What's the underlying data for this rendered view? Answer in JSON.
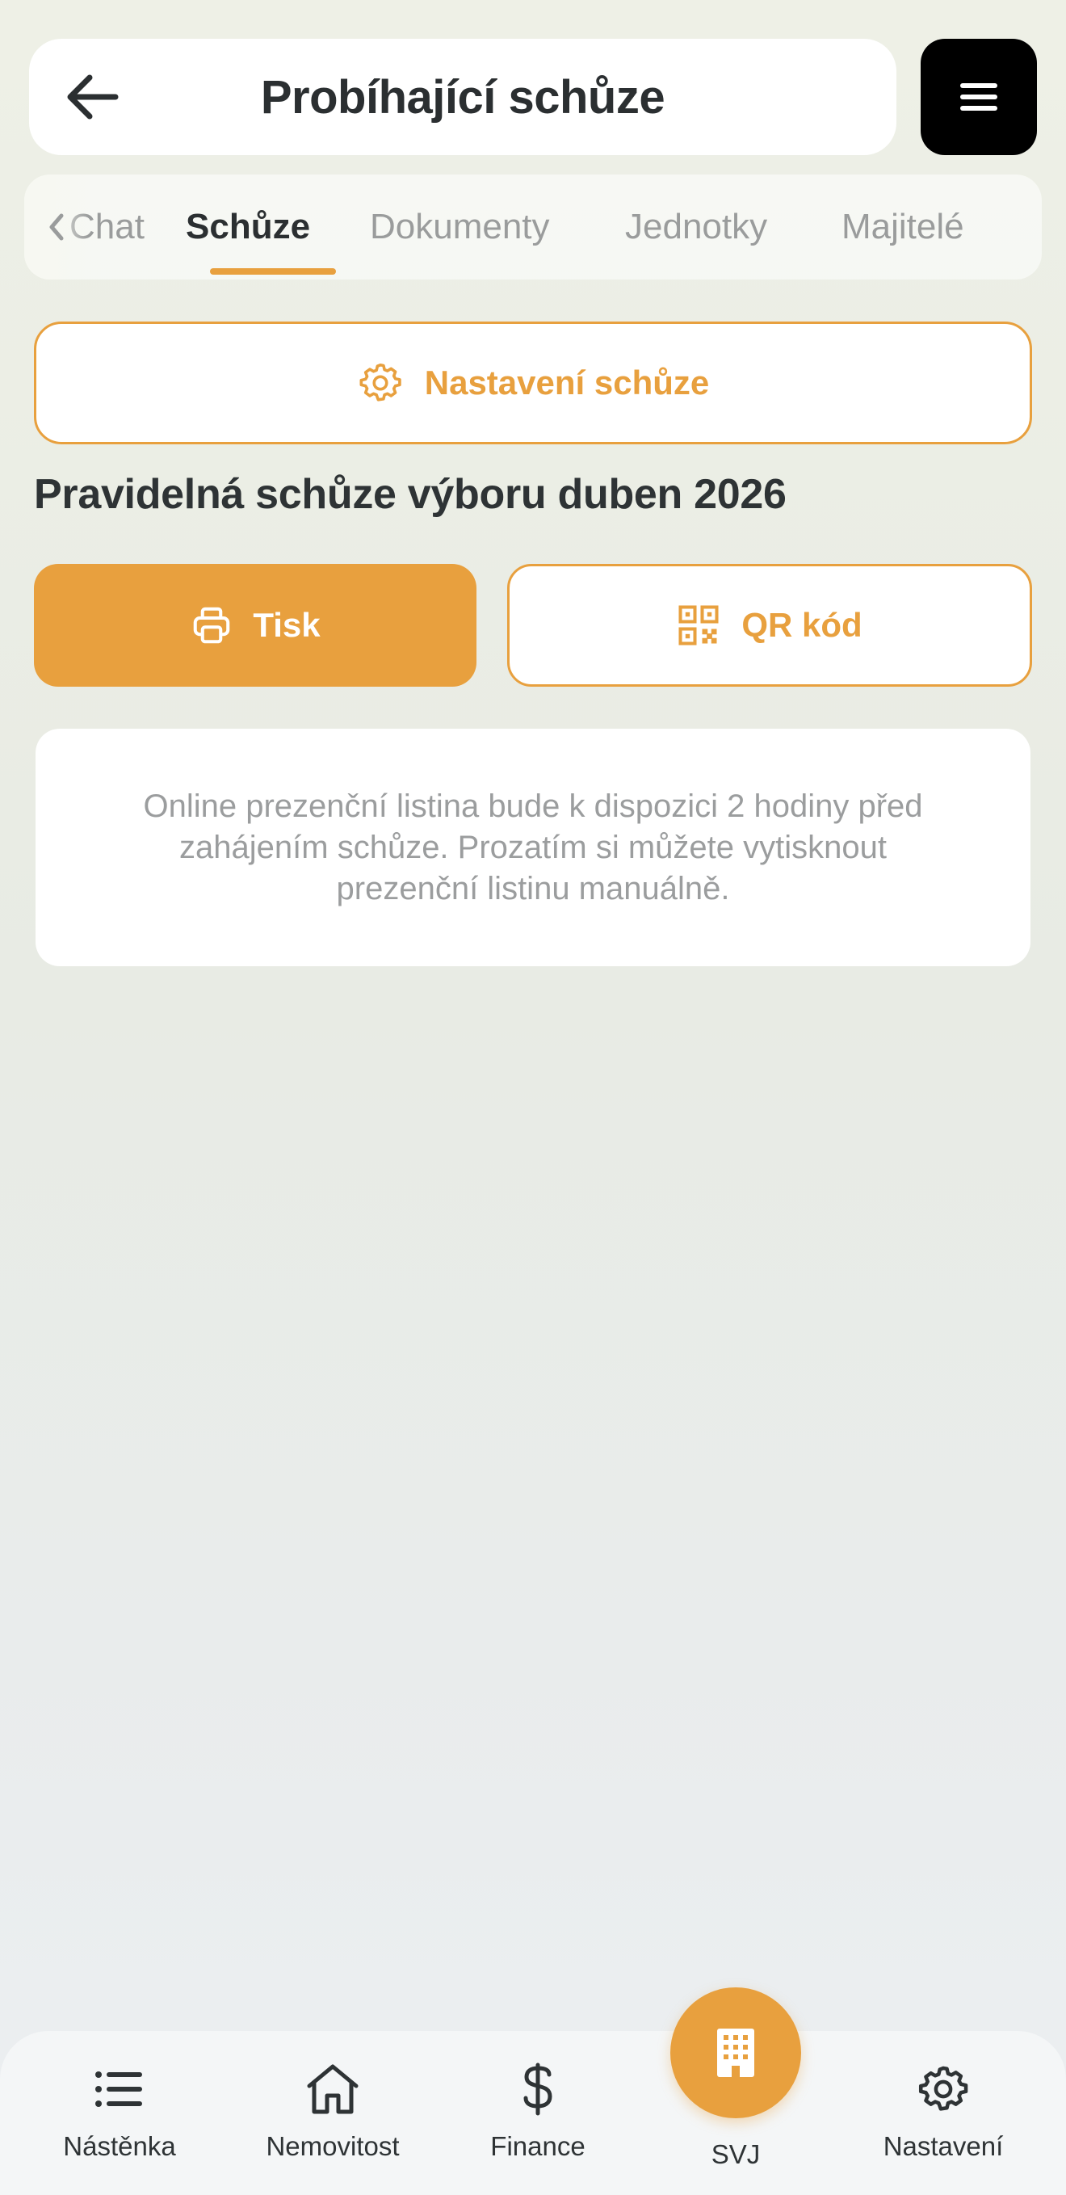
{
  "header": {
    "title": "Probíhající schůze",
    "back_icon": "arrow-left-icon",
    "menu_icon": "hamburger-menu-icon"
  },
  "tabs": [
    {
      "label": "Chat",
      "active": false
    },
    {
      "label": "Schůze",
      "active": true
    },
    {
      "label": "Dokumenty",
      "active": false
    },
    {
      "label": "Jednotky",
      "active": false
    },
    {
      "label": "Majitelé",
      "active": false
    }
  ],
  "settings_button": {
    "label": "Nastavení schůze",
    "icon": "gear-icon"
  },
  "meeting": {
    "title": "Pravidelná schůze výboru duben 2026"
  },
  "actions": {
    "print_label": "Tisk",
    "print_icon": "printer-icon",
    "qr_label": "QR kód",
    "qr_icon": "qr-code-icon"
  },
  "info": {
    "text": "Online prezenční listina bude k dispozici 2 hodiny před zahájením schůze. Prozatím si můžete vytisknout prezenční listinu manuálně."
  },
  "bottom_nav": [
    {
      "label": "Nástěnka",
      "icon": "list-icon"
    },
    {
      "label": "Nemovitost",
      "icon": "house-icon"
    },
    {
      "label": "Finance",
      "icon": "dollar-icon"
    },
    {
      "label": "SVJ",
      "icon": "building-icon",
      "active": true
    },
    {
      "label": "Nastavení",
      "icon": "gear-icon"
    }
  ],
  "colors": {
    "accent": "#e8a03e",
    "text_dark": "#2e3335",
    "text_muted": "#9b9d9e"
  }
}
